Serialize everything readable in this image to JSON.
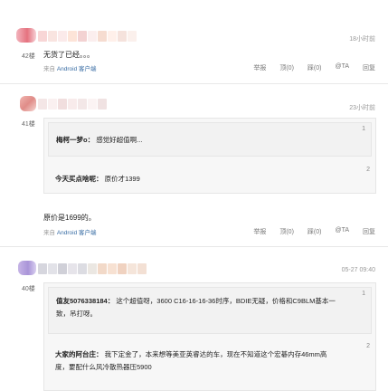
{
  "posts": [
    {
      "floor": "42楼",
      "time": "18小时前",
      "content": "无货了已经。。。",
      "source_prefix": "来自",
      "source_client": "Android 客户端",
      "actions": [
        "举报",
        "顶(0)",
        "踩(0)",
        "@TA",
        "回复"
      ]
    },
    {
      "floor": "41楼",
      "time": "23小时前",
      "quotes": [
        {
          "num": "1",
          "author": "梅柯一梦o：",
          "text": "感觉好超值啊..."
        },
        {
          "num": "2",
          "author": "今天买点啥呢：",
          "text": "原价才1399"
        }
      ],
      "content": "原价是1699的。",
      "source_prefix": "来自",
      "source_client": "Android 客户端",
      "actions": [
        "举报",
        "顶(0)",
        "踩(0)",
        "@TA",
        "回复"
      ]
    },
    {
      "floor": "40楼",
      "time": "05-27 09:40",
      "quotes": [
        {
          "num": "1",
          "author": "值友5076338184：",
          "text_line1": "这个超值呀，3600 C16-16-16-36时序，BDIE无疑，价格和C9BLM基本一",
          "text_line2": "致，吊打呀。"
        },
        {
          "num": "2",
          "author": "大家的阿台庄：",
          "text_line1": "我下定金了，本来想等美亚英睿达的车，现在不知道这个宏碁内存46mm高",
          "text_line2": "度，要配什么风冷散热器压5900"
        }
      ]
    }
  ],
  "colors": {
    "link": "#3a6ea5",
    "quote_bg": "#f7f7f7",
    "divider": "#e8e8e8"
  }
}
